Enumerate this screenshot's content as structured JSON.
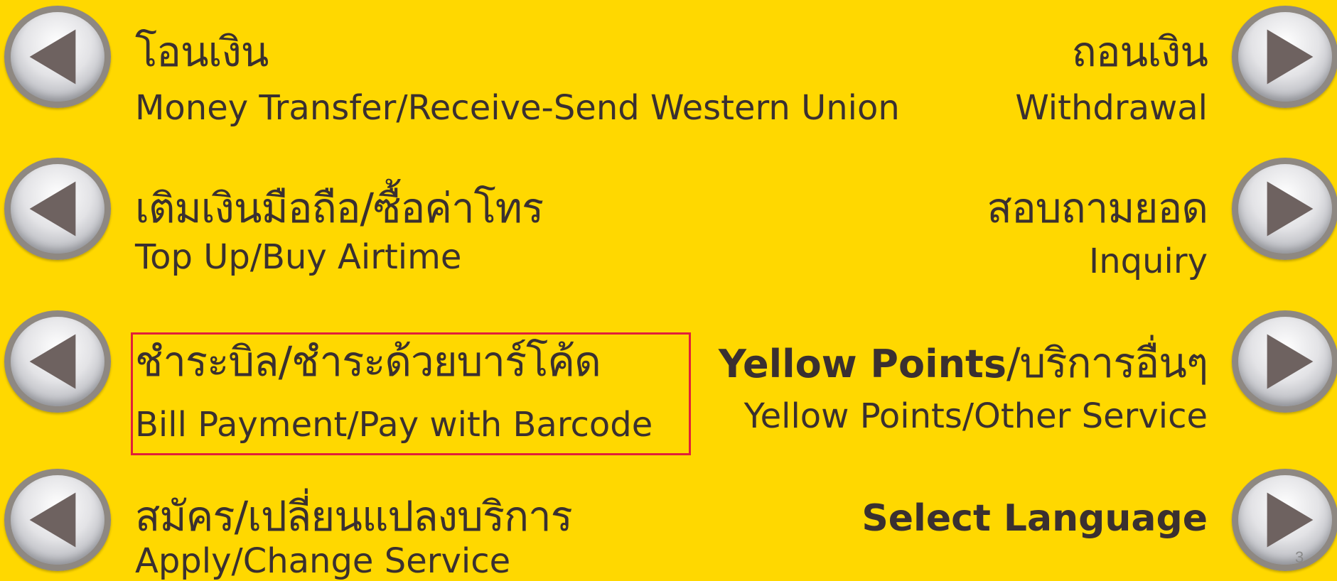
{
  "menu": {
    "left": [
      {
        "thai": "โอนเงิน",
        "english": "Money Transfer/Receive-Send  Western Union"
      },
      {
        "thai": "เติมเงินมือถือ/ซื้อค่าโทร",
        "english": "Top Up/Buy Airtime"
      },
      {
        "thai": "ชำระบิล/ชำระด้วยบาร์โค้ด",
        "english": "Bill Payment/Pay with Barcode"
      },
      {
        "thai": "สมัคร/เปลี่ยนแปลงบริการ",
        "english": "Apply/Change Service"
      }
    ],
    "right": [
      {
        "thai": "ถอนเงิน",
        "english": "Withdrawal"
      },
      {
        "thai": "สอบถามยอด",
        "english": "Inquiry"
      },
      {
        "thai_bold": "Yellow Points",
        "thai": "/บริการอื่นๆ",
        "english": "Yellow Points/Other Service"
      },
      {
        "english_bold": "Select Language"
      }
    ]
  },
  "page_number": "3",
  "colors": {
    "background": "#FFD800",
    "text": "#3a3030",
    "highlight_border": "#e0203a",
    "button_ring": "#8e8882",
    "arrow": "#6e6260"
  },
  "icons": {
    "left_buttons": "arrow-left-icon",
    "right_buttons": "arrow-right-icon"
  }
}
